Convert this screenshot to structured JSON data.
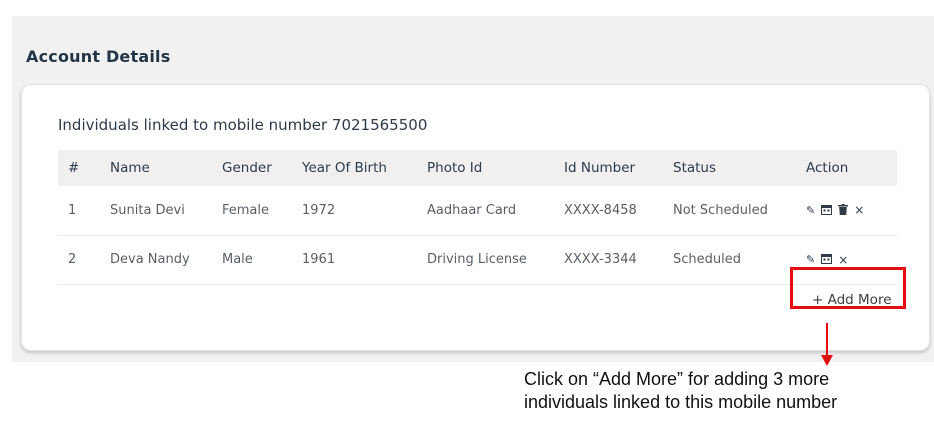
{
  "section_title": "Account Details",
  "linked_title": "Individuals linked to mobile number 7021565500",
  "table": {
    "headers": [
      "#",
      "Name",
      "Gender",
      "Year Of Birth",
      "Photo Id",
      "Id Number",
      "Status",
      "Action"
    ],
    "rows": [
      {
        "num": "1",
        "name": "Sunita Devi",
        "gender": "Female",
        "yob": "1972",
        "photo_id": "Aadhaar Card",
        "id_number": "XXXX-8458",
        "status": "Not Scheduled",
        "actions": [
          "edit-icon",
          "calendar-icon",
          "trash-icon",
          "close-icon"
        ]
      },
      {
        "num": "2",
        "name": "Deva Nandy",
        "gender": "Male",
        "yob": "1961",
        "photo_id": "Driving License",
        "id_number": "XXXX-3344",
        "status": "Scheduled",
        "actions": [
          "edit-icon",
          "calendar-icon",
          "close-icon"
        ]
      }
    ]
  },
  "add_more_label": "+ Add More",
  "callout": {
    "line1": "Click on “Add More” for adding 3 more",
    "line2": "individuals linked to this mobile number"
  },
  "colors": {
    "highlight": "#e10f0f",
    "heading": "#243447"
  }
}
